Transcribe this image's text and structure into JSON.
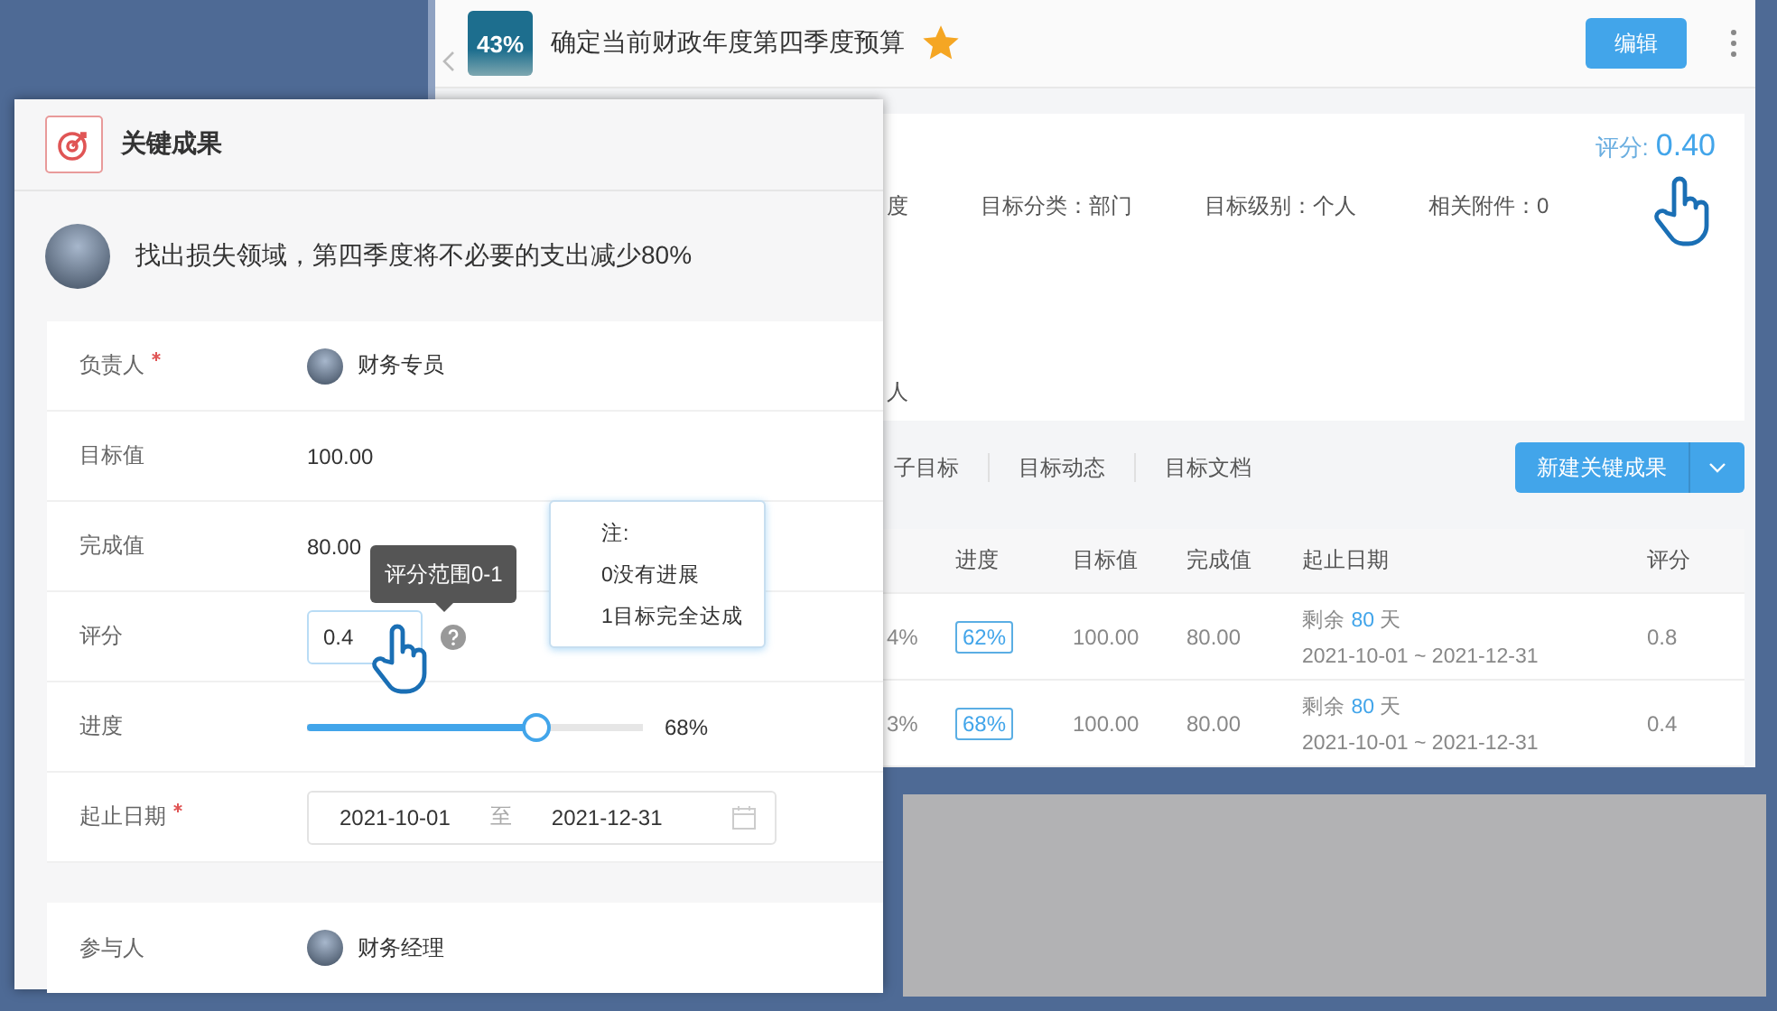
{
  "back_window": {
    "progress_badge": "43%",
    "title": "确定当前财政年度第四季度预算",
    "starred": true,
    "edit_button": "编辑",
    "score_label": "评分:",
    "score_value": "0.40",
    "meta": [
      "度",
      "目标分类：部门",
      "目标级别：个人",
      "相关附件：0"
    ],
    "meta_line_2": "人",
    "tabs": [
      "子目标",
      "目标动态",
      "目标文档"
    ],
    "new_button": "新建关键成果",
    "table": {
      "columns": [
        "进度",
        "目标值",
        "完成值",
        "起止日期",
        "评分"
      ],
      "rows": [
        {
          "column_1": "4%",
          "progress": "62%",
          "target": "100.00",
          "done": "80.00",
          "remaining_prefix": "剩余",
          "remaining_days": "80",
          "remaining_suffix": "天",
          "date_range": "2021-10-01 ~ 2021-12-31",
          "score": "0.8"
        },
        {
          "column_1": "3%",
          "progress": "68%",
          "target": "100.00",
          "done": "80.00",
          "remaining_prefix": "剩余",
          "remaining_days": "80",
          "remaining_suffix": "天",
          "date_range": "2021-10-01 ~ 2021-12-31",
          "score": "0.4"
        }
      ]
    }
  },
  "front_panel": {
    "title": "关键成果",
    "objective": "找出损失领域，第四季度将不必要的支出减少80%",
    "fields": [
      {
        "kind": "person",
        "label": "负责人",
        "required": true,
        "value": "财务专员"
      },
      {
        "kind": "text",
        "label": "目标值",
        "required": false,
        "value": "100.00"
      },
      {
        "kind": "text",
        "label": "完成值",
        "required": false,
        "value": "80.00"
      },
      {
        "kind": "input",
        "label": "评分",
        "required": false,
        "value": "0.4"
      },
      {
        "kind": "slider",
        "label": "进度",
        "required": false,
        "level": 0.68,
        "reading": "68%"
      },
      {
        "kind": "daterange",
        "label": "起止日期",
        "required": true,
        "start": "2021-10-01",
        "separator": "至",
        "end": "2021-12-31"
      }
    ],
    "participant": {
      "label": "参与人",
      "value": "财务经理"
    },
    "tooltip": "评分范围0-1",
    "note": {
      "title": "注:",
      "lines": [
        "0没有进展",
        "1目标完全达成"
      ]
    }
  }
}
